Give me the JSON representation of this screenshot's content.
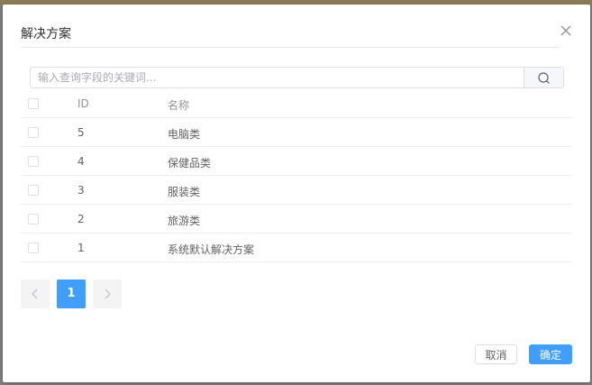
{
  "dialog": {
    "title": "解决方案",
    "search": {
      "placeholder": "输入查询字段的关键词..."
    },
    "table": {
      "headers": {
        "id": "ID",
        "name": "名称"
      },
      "rows": [
        {
          "id": "5",
          "name": "电脑类"
        },
        {
          "id": "4",
          "name": "保健品类"
        },
        {
          "id": "3",
          "name": "服装类"
        },
        {
          "id": "2",
          "name": "旅游类"
        },
        {
          "id": "1",
          "name": "系统默认解决方案"
        }
      ]
    },
    "pagination": {
      "current": "1",
      "prev_icon": "chevron-left-icon",
      "next_icon": "chevron-right-icon"
    },
    "footer": {
      "cancel_label": "取消",
      "ok_label": "确定"
    }
  },
  "colors": {
    "primary": "#409eff",
    "border": "#dcdfe6",
    "text": "#606266"
  }
}
